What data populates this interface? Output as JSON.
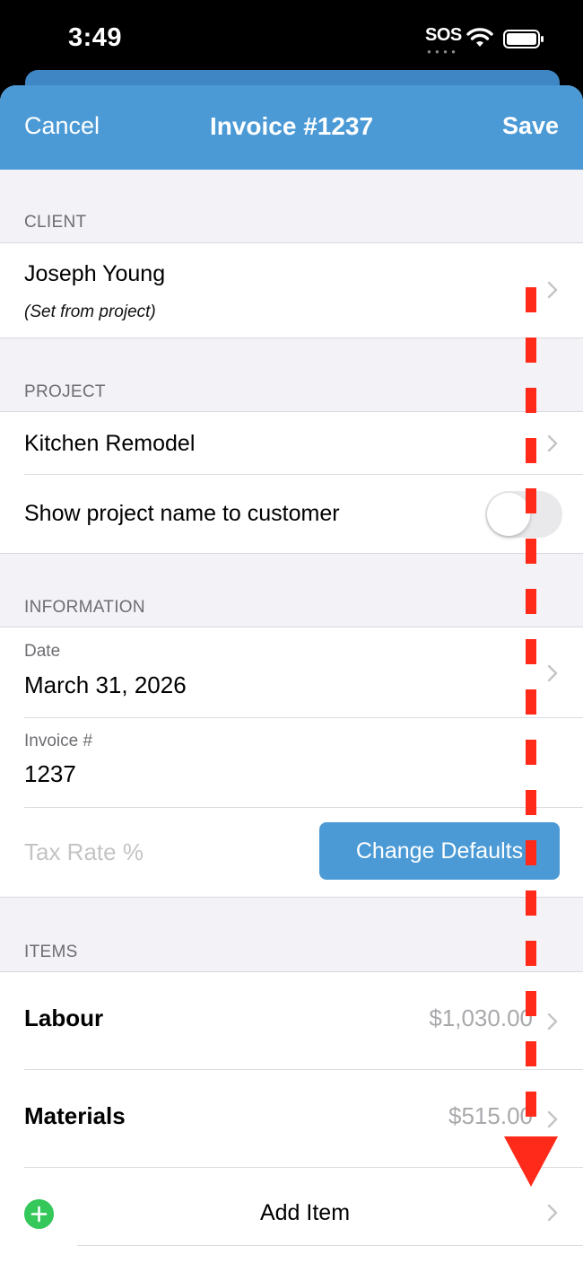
{
  "status_bar": {
    "time": "3:49",
    "carrier": "SOS",
    "wifi_icon": "wifi-icon",
    "battery_icon": "battery-icon"
  },
  "nav": {
    "cancel_label": "Cancel",
    "title": "Invoice #1237",
    "save_label": "Save"
  },
  "client": {
    "header": "CLIENT",
    "name": "Joseph Young",
    "note": "(Set from project)"
  },
  "project": {
    "header": "PROJECT",
    "name": "Kitchen Remodel",
    "show_name_label": "Show project name to customer",
    "show_name_enabled": false
  },
  "information": {
    "header": "INFORMATION",
    "date_label": "Date",
    "date_value": "March 31, 2026",
    "invoice_label": "Invoice #",
    "invoice_value": "1237",
    "tax_placeholder": "Tax Rate %",
    "change_defaults_label": "Change Defaults"
  },
  "items": {
    "header": "ITEMS",
    "list": [
      {
        "name": "Labour",
        "amount": "$1,030.00"
      },
      {
        "name": "Materials",
        "amount": "$515.00"
      }
    ],
    "add_label": "Add Item"
  },
  "colors": {
    "nav_blue": "#4b9ad6",
    "add_green": "#34c759",
    "scroll_arrow_red": "#ff2a1a"
  }
}
